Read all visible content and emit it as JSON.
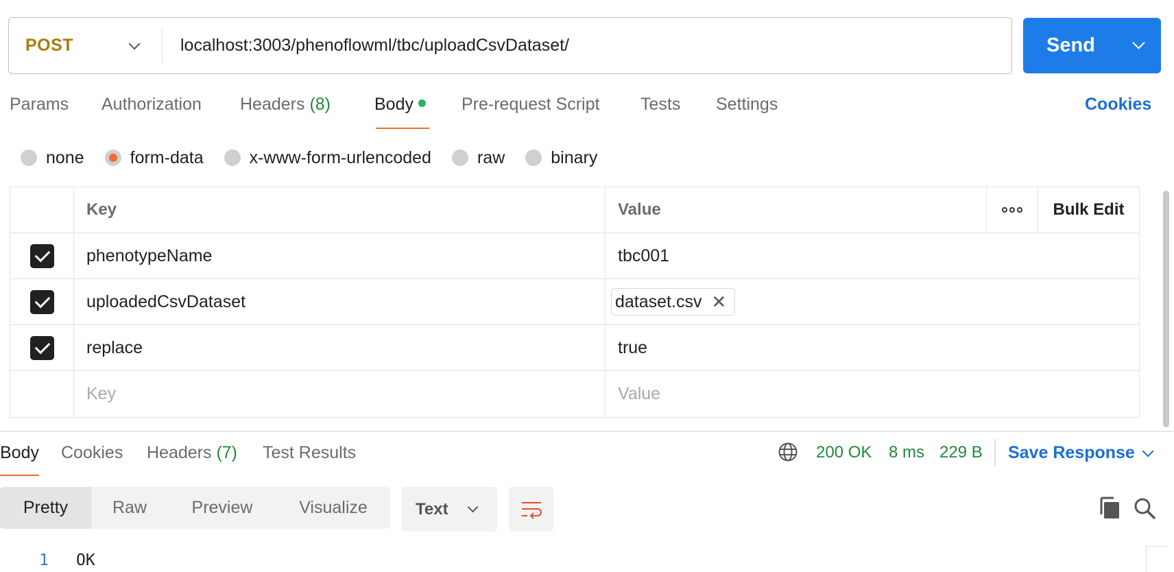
{
  "request": {
    "method": "POST",
    "url": "localhost:3003/phenoflowml/tbc/uploadCsvDataset/",
    "send_label": "Send"
  },
  "request_tabs": {
    "params": "Params",
    "authorization": "Authorization",
    "headers": "Headers",
    "headers_count": "(8)",
    "body": "Body",
    "prerequest": "Pre-request Script",
    "tests": "Tests",
    "settings": "Settings",
    "cookies": "Cookies"
  },
  "body_types": {
    "none": "none",
    "form_data": "form-data",
    "urlencoded": "x-www-form-urlencoded",
    "raw": "raw",
    "binary": "binary",
    "selected": "form-data"
  },
  "form_table": {
    "headers": {
      "key": "Key",
      "value": "Value",
      "bulk_edit": "Bulk Edit"
    },
    "rows": [
      {
        "checked": true,
        "key": "phenotypeName",
        "value": "tbc001"
      },
      {
        "checked": true,
        "key": "uploadedCsvDataset",
        "value": "dataset.csv",
        "is_file": true
      },
      {
        "checked": true,
        "key": "replace",
        "value": "true"
      }
    ],
    "placeholder_key": "Key",
    "placeholder_value": "Value"
  },
  "response_tabs": {
    "body": "Body",
    "cookies": "Cookies",
    "headers": "Headers",
    "headers_count": "(7)",
    "test_results": "Test Results"
  },
  "response_status": {
    "status": "200 OK",
    "time": "8 ms",
    "size": "229 B",
    "save_response": "Save Response"
  },
  "response_view": {
    "pretty": "Pretty",
    "raw": "Raw",
    "preview": "Preview",
    "visualize": "Visualize",
    "format": "Text"
  },
  "response_body": {
    "lines": [
      {
        "num": "1",
        "text": "OK"
      }
    ]
  },
  "colors": {
    "accent": "#1d7ce8",
    "method": "#a97c0a",
    "success": "#1f8a3b",
    "active_tab": "#ef6c2b"
  }
}
